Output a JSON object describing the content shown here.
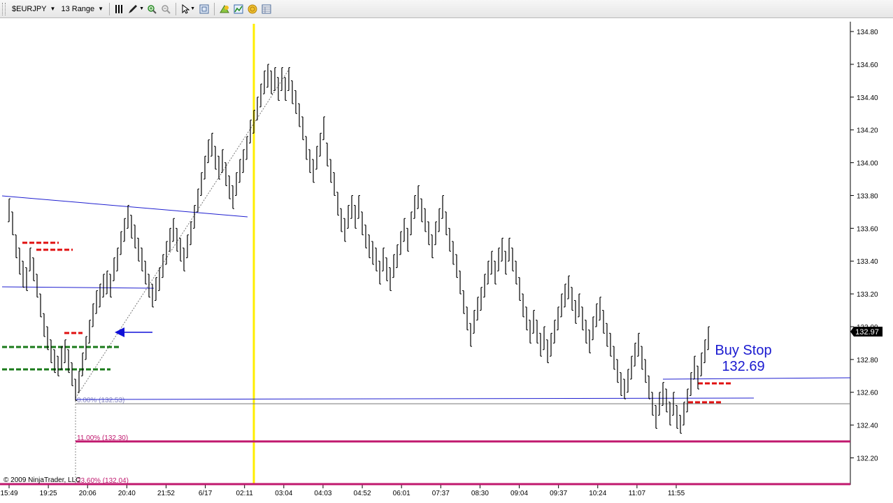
{
  "toolbar": {
    "instrument": "$EURJPY",
    "period": "13 Range",
    "icons": [
      "bar-style-icon",
      "drawing-pencil-icon",
      "zoom-in-icon",
      "zoom-out-icon",
      "cursor-pointer-icon",
      "chart-properties-icon",
      "strategies-icon",
      "indicators-icon",
      "gold-coin-icon",
      "data-box-icon"
    ]
  },
  "chart_data": {
    "type": "ohlc",
    "ylim": [
      132.04,
      134.86
    ],
    "price_ticks": [
      "134.80",
      "134.60",
      "134.40",
      "134.20",
      "134.00",
      "133.80",
      "133.60",
      "133.40",
      "133.20",
      "133.00",
      "132.80",
      "132.60",
      "132.40",
      "132.20"
    ],
    "time_ticks": [
      "15:49",
      "19:25",
      "20:06",
      "20:40",
      "21:52",
      "6/17",
      "02:11",
      "03:04",
      "04:03",
      "04:52",
      "06:01",
      "07:37",
      "08:30",
      "09:04",
      "09:37",
      "10:24",
      "11:07",
      "11:55"
    ],
    "last_price": "132.97",
    "fib_levels": [
      {
        "label": "0.00% (132.53)",
        "price": 132.53
      },
      {
        "label": "11.00% (132.30)",
        "price": 132.3
      },
      {
        "label": "23.60% (132.04)",
        "price": 132.04
      }
    ],
    "annotation": {
      "line1": "Buy Stop",
      "line2": "132.69"
    },
    "copyright": "© 2009 NinjaTrader, LLC",
    "colors": {
      "bar": "#000000",
      "trend": "#1f1fd0",
      "stop": "#e01010",
      "target": "#1a7a1a",
      "session": "#ffee00",
      "fib": "#c0186e",
      "arrow": "#1010d8"
    },
    "bars": [
      [
        133.78,
        133.64
      ],
      [
        133.7,
        133.56
      ],
      [
        133.56,
        133.42
      ],
      [
        133.48,
        133.32
      ],
      [
        133.4,
        133.24
      ],
      [
        133.36,
        133.22
      ],
      [
        133.48,
        133.34
      ],
      [
        133.42,
        133.28
      ],
      [
        133.32,
        133.18
      ],
      [
        133.2,
        133.06
      ],
      [
        133.08,
        132.94
      ],
      [
        133.0,
        132.86
      ],
      [
        132.92,
        132.78
      ],
      [
        132.86,
        132.72
      ],
      [
        132.82,
        132.7
      ],
      [
        132.88,
        132.74
      ],
      [
        132.92,
        132.78
      ],
      [
        132.86,
        132.72
      ],
      [
        132.78,
        132.64
      ],
      [
        132.68,
        132.55
      ],
      [
        132.73,
        132.6
      ],
      [
        132.84,
        132.7
      ],
      [
        132.94,
        132.8
      ],
      [
        133.04,
        132.9
      ],
      [
        133.14,
        133.0
      ],
      [
        133.22,
        133.08
      ],
      [
        133.26,
        133.12
      ],
      [
        133.32,
        133.18
      ],
      [
        133.34,
        133.2
      ],
      [
        133.32,
        133.18
      ],
      [
        133.42,
        133.28
      ],
      [
        133.48,
        133.34
      ],
      [
        133.58,
        133.44
      ],
      [
        133.66,
        133.52
      ],
      [
        133.74,
        133.6
      ],
      [
        133.68,
        133.54
      ],
      [
        133.62,
        133.48
      ],
      [
        133.54,
        133.4
      ],
      [
        133.48,
        133.34
      ],
      [
        133.4,
        133.26
      ],
      [
        133.32,
        133.18
      ],
      [
        133.26,
        133.12
      ],
      [
        133.3,
        133.16
      ],
      [
        133.36,
        133.22
      ],
      [
        133.44,
        133.3
      ],
      [
        133.52,
        133.38
      ],
      [
        133.6,
        133.46
      ],
      [
        133.66,
        133.52
      ],
      [
        133.6,
        133.46
      ],
      [
        133.54,
        133.4
      ],
      [
        133.48,
        133.34
      ],
      [
        133.56,
        133.42
      ],
      [
        133.64,
        133.5
      ],
      [
        133.74,
        133.6
      ],
      [
        133.84,
        133.7
      ],
      [
        133.94,
        133.8
      ],
      [
        134.04,
        133.9
      ],
      [
        134.14,
        134.0
      ],
      [
        134.18,
        134.04
      ],
      [
        134.1,
        133.96
      ],
      [
        134.04,
        133.9
      ],
      [
        134.08,
        133.94
      ],
      [
        134.0,
        133.86
      ],
      [
        133.92,
        133.78
      ],
      [
        133.86,
        133.72
      ],
      [
        133.94,
        133.8
      ],
      [
        134.02,
        133.88
      ],
      [
        134.08,
        133.94
      ],
      [
        134.16,
        134.02
      ],
      [
        134.26,
        134.12
      ],
      [
        134.32,
        134.18
      ],
      [
        134.4,
        134.26
      ],
      [
        134.48,
        134.34
      ],
      [
        134.56,
        134.42
      ],
      [
        134.6,
        134.46
      ],
      [
        134.56,
        134.42
      ],
      [
        134.58,
        134.44
      ],
      [
        134.52,
        134.38
      ],
      [
        134.58,
        134.44
      ],
      [
        134.52,
        134.38
      ],
      [
        134.58,
        134.44
      ],
      [
        134.5,
        134.36
      ],
      [
        134.44,
        134.3
      ],
      [
        134.36,
        134.22
      ],
      [
        134.28,
        134.14
      ],
      [
        134.16,
        134.02
      ],
      [
        134.08,
        133.94
      ],
      [
        134.02,
        133.88
      ],
      [
        134.1,
        133.96
      ],
      [
        134.18,
        134.04
      ],
      [
        134.28,
        134.14
      ],
      [
        134.12,
        133.98
      ],
      [
        134.02,
        133.88
      ],
      [
        133.94,
        133.8
      ],
      [
        133.82,
        133.68
      ],
      [
        133.72,
        133.58
      ],
      [
        133.66,
        133.52
      ],
      [
        133.74,
        133.6
      ],
      [
        133.8,
        133.66
      ],
      [
        133.74,
        133.6
      ],
      [
        133.8,
        133.66
      ],
      [
        133.7,
        133.56
      ],
      [
        133.62,
        133.48
      ],
      [
        133.56,
        133.42
      ],
      [
        133.52,
        133.38
      ],
      [
        133.48,
        133.34
      ],
      [
        133.4,
        133.26
      ],
      [
        133.48,
        133.34
      ],
      [
        133.42,
        133.28
      ],
      [
        133.36,
        133.22
      ],
      [
        133.44,
        133.3
      ],
      [
        133.5,
        133.36
      ],
      [
        133.58,
        133.44
      ],
      [
        133.66,
        133.52
      ],
      [
        133.6,
        133.46
      ],
      [
        133.7,
        133.56
      ],
      [
        133.8,
        133.66
      ],
      [
        133.86,
        133.72
      ],
      [
        133.78,
        133.64
      ],
      [
        133.72,
        133.58
      ],
      [
        133.64,
        133.5
      ],
      [
        133.56,
        133.42
      ],
      [
        133.64,
        133.5
      ],
      [
        133.72,
        133.58
      ],
      [
        133.8,
        133.66
      ],
      [
        133.7,
        133.56
      ],
      [
        133.6,
        133.46
      ],
      [
        133.52,
        133.38
      ],
      [
        133.44,
        133.3
      ],
      [
        133.34,
        133.2
      ],
      [
        133.22,
        133.08
      ],
      [
        133.12,
        132.98
      ],
      [
        133.02,
        132.88
      ],
      [
        133.1,
        132.96
      ],
      [
        133.18,
        133.04
      ],
      [
        133.24,
        133.1
      ],
      [
        133.32,
        133.18
      ],
      [
        133.4,
        133.26
      ],
      [
        133.46,
        133.32
      ],
      [
        133.4,
        133.26
      ],
      [
        133.48,
        133.34
      ],
      [
        133.54,
        133.4
      ],
      [
        133.46,
        133.32
      ],
      [
        133.54,
        133.4
      ],
      [
        133.48,
        133.34
      ],
      [
        133.4,
        133.26
      ],
      [
        133.3,
        133.16
      ],
      [
        133.2,
        133.06
      ],
      [
        133.12,
        132.98
      ],
      [
        133.04,
        132.9
      ],
      [
        133.1,
        132.96
      ],
      [
        133.04,
        132.9
      ],
      [
        132.96,
        132.82
      ],
      [
        133.0,
        132.86
      ],
      [
        132.92,
        132.78
      ],
      [
        132.96,
        132.82
      ],
      [
        133.04,
        132.9
      ],
      [
        133.12,
        132.98
      ],
      [
        133.2,
        133.06
      ],
      [
        133.26,
        133.12
      ],
      [
        133.31,
        133.17
      ],
      [
        133.24,
        133.1
      ],
      [
        133.16,
        133.02
      ],
      [
        133.2,
        133.06
      ],
      [
        133.12,
        132.98
      ],
      [
        133.04,
        132.9
      ],
      [
        132.98,
        132.84
      ],
      [
        133.06,
        132.92
      ],
      [
        133.14,
        133.0
      ],
      [
        133.18,
        133.04
      ],
      [
        133.1,
        132.96
      ],
      [
        133.02,
        132.88
      ],
      [
        132.96,
        132.82
      ],
      [
        132.88,
        132.74
      ],
      [
        132.8,
        132.66
      ],
      [
        132.72,
        132.58
      ],
      [
        132.68,
        132.56
      ],
      [
        132.74,
        132.6
      ],
      [
        132.82,
        132.68
      ],
      [
        132.9,
        132.76
      ],
      [
        132.96,
        132.82
      ],
      [
        132.88,
        132.74
      ],
      [
        132.8,
        132.66
      ],
      [
        132.7,
        132.56
      ],
      [
        132.6,
        132.46
      ],
      [
        132.52,
        132.38
      ],
      [
        132.6,
        132.46
      ],
      [
        132.66,
        132.52
      ],
      [
        132.62,
        132.48
      ],
      [
        132.54,
        132.4
      ],
      [
        132.6,
        132.46
      ],
      [
        132.52,
        132.38
      ],
      [
        132.46,
        132.35
      ],
      [
        132.54,
        132.4
      ],
      [
        132.62,
        132.48
      ],
      [
        132.72,
        132.58
      ],
      [
        132.82,
        132.68
      ],
      [
        132.76,
        132.62
      ],
      [
        132.84,
        132.7
      ],
      [
        132.92,
        132.78
      ],
      [
        133.0,
        132.86
      ]
    ]
  }
}
